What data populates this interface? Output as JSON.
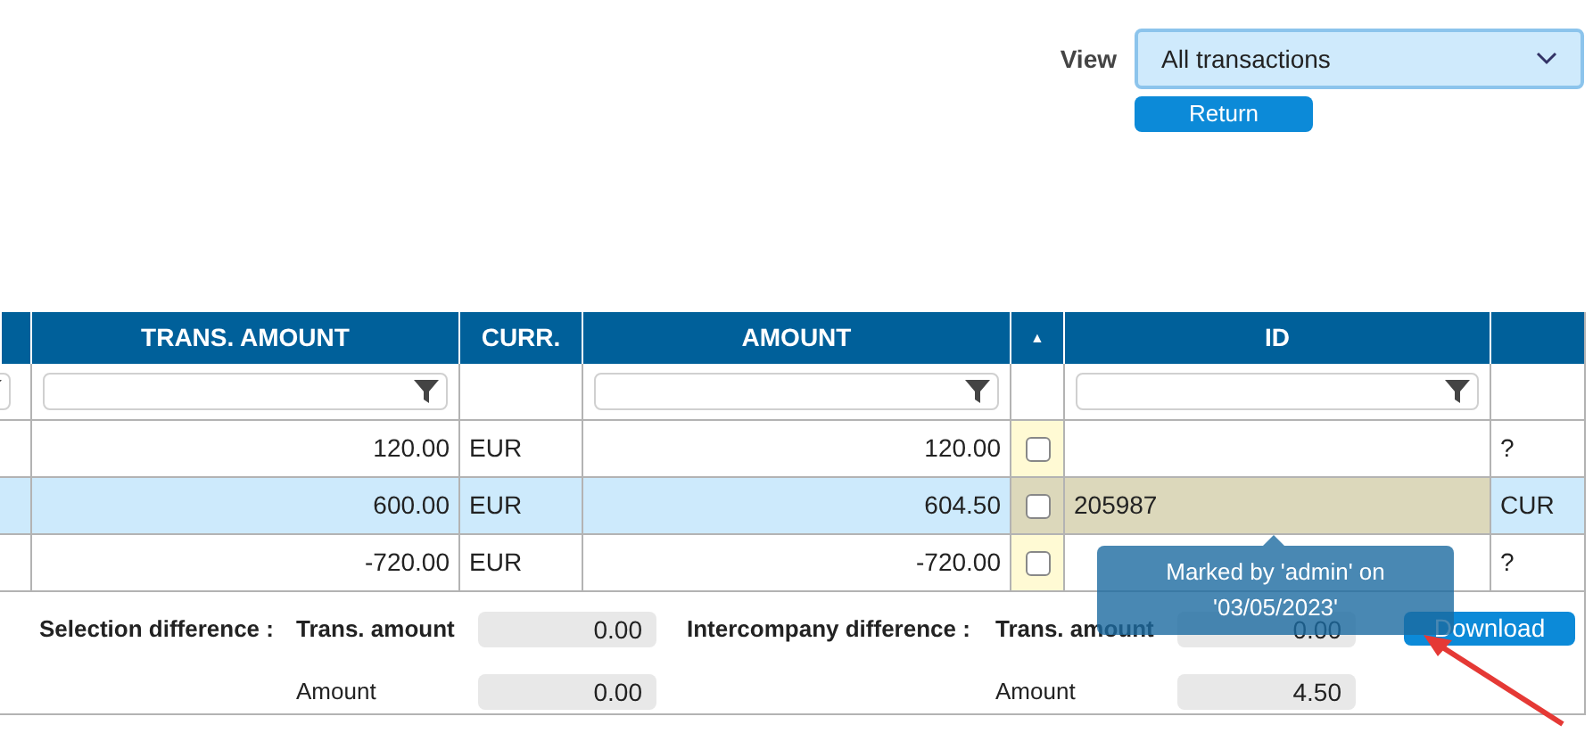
{
  "view": {
    "label": "View",
    "value": "All transactions"
  },
  "return_button": "Return",
  "table": {
    "columns": [
      {
        "filter": true
      },
      {
        "label": "TRANS. AMOUNT",
        "filter": true
      },
      {
        "label": "CURR.",
        "filter": false
      },
      {
        "label": "AMOUNT",
        "filter": true
      },
      {
        "sort_indicator": "▲",
        "filter": false
      },
      {
        "label": "ID",
        "filter": true
      },
      {
        "filter": false
      }
    ],
    "rows": [
      {
        "trans_amount": "120.00",
        "curr": "EUR",
        "amount": "120.00",
        "checked": false,
        "column_7": "?",
        "selected": false,
        "marked": false
      },
      {
        "trans_amount": "600.00",
        "curr": "EUR",
        "amount": "604.50",
        "checked": false,
        "id": "205987",
        "column_7": "CUR",
        "selected": true,
        "marked": true
      },
      {
        "trans_amount": "-720.00",
        "curr": "EUR",
        "amount": "-720.00",
        "checked": false,
        "column_7": "?",
        "selected": false,
        "marked": false
      }
    ]
  },
  "tooltip": "Marked by 'admin' on '03/05/2023'",
  "footer": {
    "selection_difference": {
      "label": "Selection difference :",
      "rows": [
        {
          "label": "Trans. amount",
          "value": "0.00"
        },
        {
          "label": "Amount",
          "value": "0.00"
        }
      ]
    },
    "intercompany_difference": {
      "label": "Intercompany difference :",
      "rows": [
        {
          "label": "Trans. amount",
          "value": "0.00"
        },
        {
          "label": "Amount",
          "value": "4.50"
        }
      ]
    },
    "download_button": "Download"
  }
}
